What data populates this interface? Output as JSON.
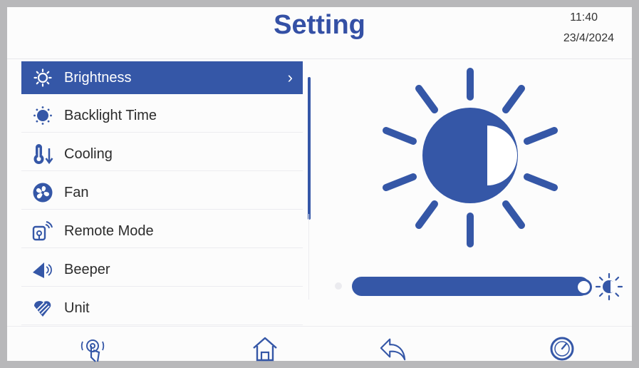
{
  "header": {
    "title": "Setting",
    "time": "11:40",
    "date": "23/4/2024"
  },
  "menu": {
    "items": [
      {
        "label": "Brightness",
        "icon": "brightness-icon",
        "active": true
      },
      {
        "label": "Backlight Time",
        "icon": "backlight-icon",
        "active": false
      },
      {
        "label": "Cooling",
        "icon": "thermometer-icon",
        "active": false
      },
      {
        "label": "Fan",
        "icon": "fan-icon",
        "active": false
      },
      {
        "label": "Remote Mode",
        "icon": "remote-icon",
        "active": false
      },
      {
        "label": "Beeper",
        "icon": "speaker-icon",
        "active": false
      },
      {
        "label": "Unit",
        "icon": "unit-icon",
        "active": false
      }
    ],
    "active_chevron": "›"
  },
  "brightness": {
    "level": 1.0
  },
  "footer": {
    "icons": [
      "touch-icon",
      "home-icon",
      "back-icon",
      "gauge-icon"
    ]
  },
  "colors": {
    "accent": "#3557a7",
    "title": "#3450a5",
    "frame": "#b8b8ba"
  }
}
